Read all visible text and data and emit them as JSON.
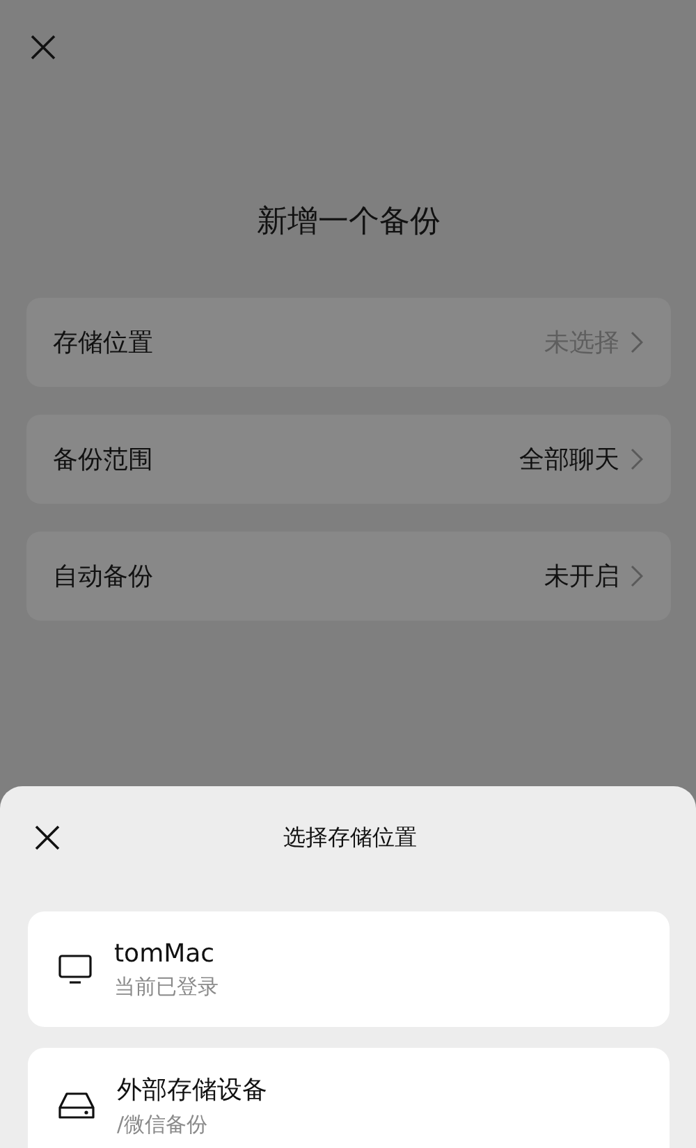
{
  "page": {
    "title": "新增一个备份"
  },
  "settings": [
    {
      "label": "存储位置",
      "value": "未选择",
      "empty": true
    },
    {
      "label": "备份范围",
      "value": "全部聊天",
      "empty": false
    },
    {
      "label": "自动备份",
      "value": "未开启",
      "empty": false
    }
  ],
  "sheet": {
    "title": "选择存储位置",
    "locations": [
      {
        "kind": "computer",
        "name": "tomMac",
        "detail": "当前已登录"
      },
      {
        "kind": "drive",
        "name": "外部存储设备",
        "detail": "/微信备份"
      }
    ]
  }
}
